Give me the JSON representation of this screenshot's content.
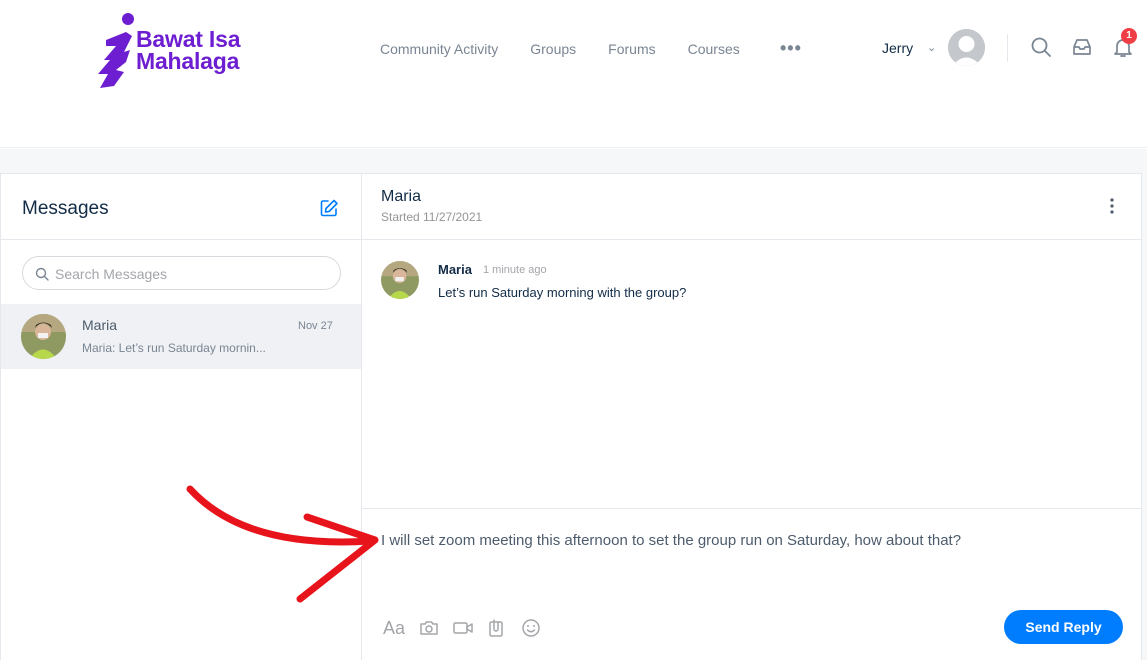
{
  "brand": {
    "line1": "Bawat Isa",
    "line2": "Mahalaga",
    "color": "#6d1ed1"
  },
  "nav": {
    "items": [
      "Community Activity",
      "Groups",
      "Forums",
      "Courses"
    ],
    "more": "•••"
  },
  "user": {
    "name": "Jerry",
    "notifications": "1"
  },
  "messages_panel": {
    "title": "Messages",
    "search_placeholder": "Search Messages",
    "threads": [
      {
        "name": "Maria",
        "date": "Nov 27",
        "preview": "Maria: Let’s run Saturday mornin..."
      }
    ]
  },
  "conversation": {
    "name": "Maria",
    "started": "Started 11/27/2021",
    "messages": [
      {
        "author": "Maria",
        "time": "1 minute ago",
        "text": "Let’s run Saturday morning with the group?"
      }
    ],
    "reply_draft": "I will set zoom meeting this afternoon to set the group run on Saturday, how about that?",
    "send_label": "Send Reply",
    "format_label": "Aa"
  },
  "colors": {
    "accent": "#007cff",
    "badge": "#ef3e46",
    "annotation": "#e8141c"
  },
  "icons": [
    "compose-icon",
    "search-icon",
    "inbox-icon",
    "bell-icon",
    "camera-icon",
    "video-icon",
    "attachment-icon",
    "emoji-icon",
    "more-vertical-icon"
  ]
}
